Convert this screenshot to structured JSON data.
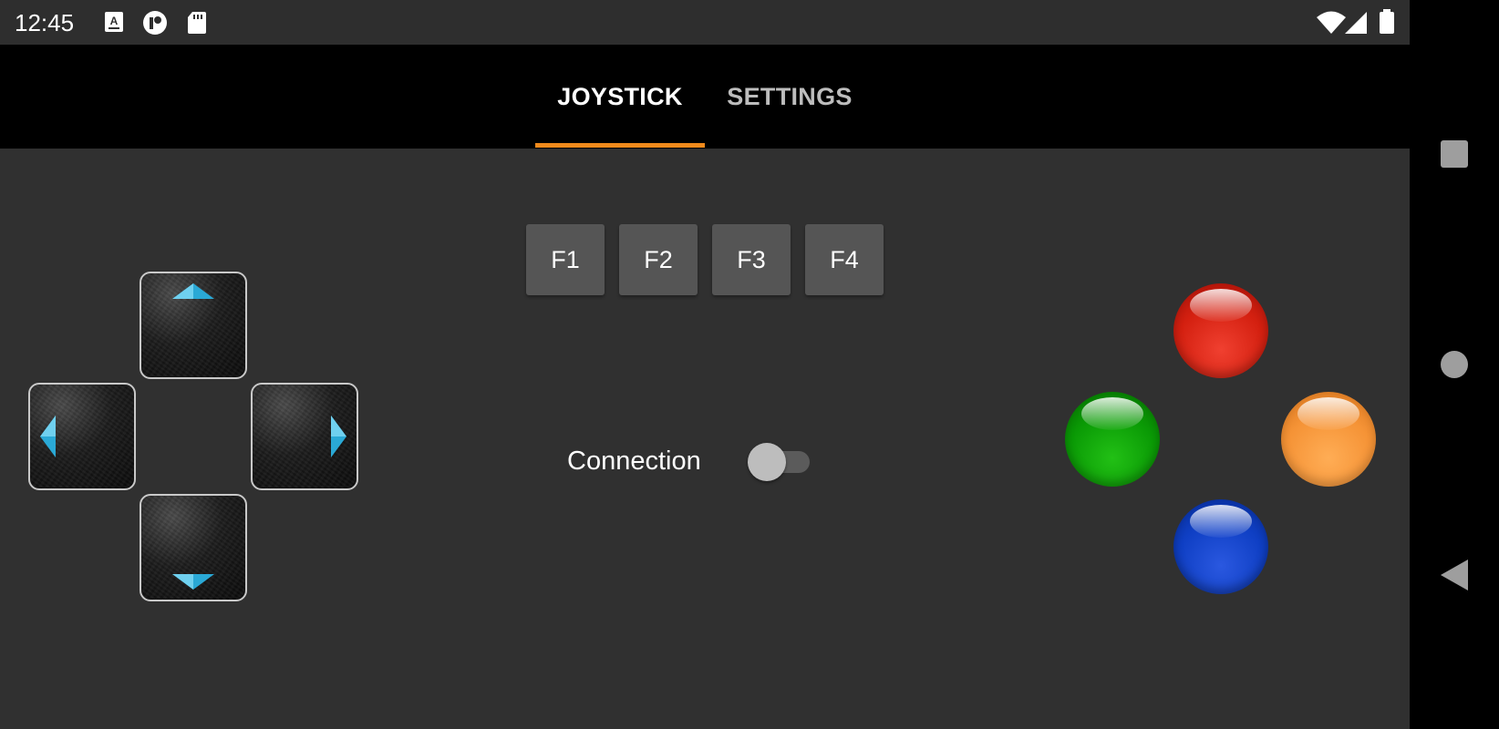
{
  "status_bar": {
    "time": "12:45",
    "left_icons": [
      "translate-a-icon",
      "notification-app-icon",
      "sd-card-icon"
    ],
    "right_icons": [
      "wifi-icon",
      "cell-signal-icon",
      "battery-icon"
    ]
  },
  "tabs": [
    {
      "label": "JOYSTICK",
      "active": true
    },
    {
      "label": "SETTINGS",
      "active": false
    }
  ],
  "accent_color": "#f08a1c",
  "function_keys": [
    "F1",
    "F2",
    "F3",
    "F4"
  ],
  "connection": {
    "label": "Connection",
    "enabled": false
  },
  "dpad": [
    "up",
    "left",
    "right",
    "down"
  ],
  "action_buttons": [
    {
      "position": "top",
      "color": "#d42010"
    },
    {
      "position": "left",
      "color": "#0a9a05"
    },
    {
      "position": "right",
      "color": "#f59336"
    },
    {
      "position": "bottom",
      "color": "#0f3fc4"
    }
  ],
  "nav_bar": [
    "recents-square-icon",
    "home-circle-icon",
    "back-triangle-icon"
  ]
}
